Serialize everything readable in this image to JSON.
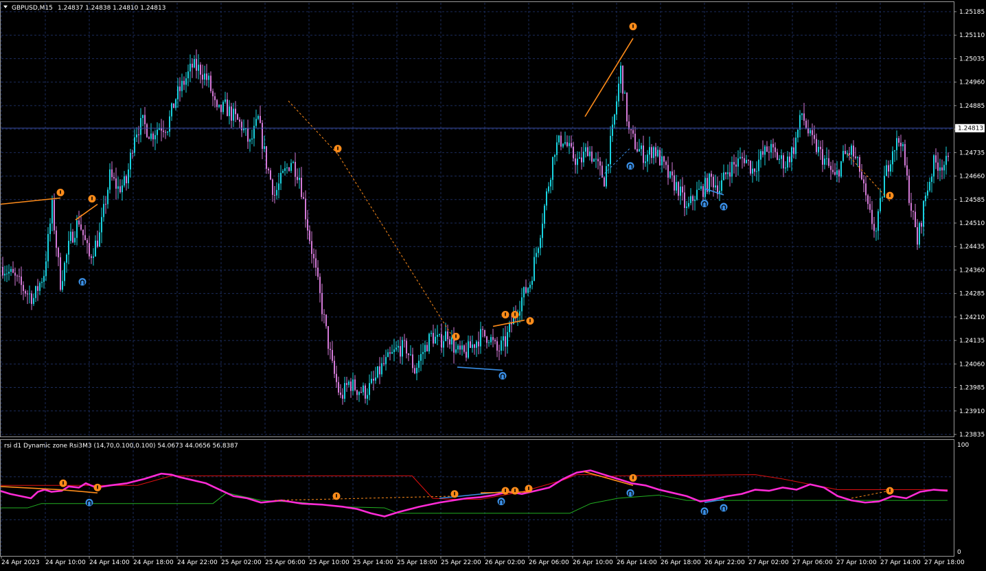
{
  "header": {
    "symbol": "GBPUSD,M15",
    "ohlc": "1.24837 1.24838 1.24810 1.24813"
  },
  "current_price_label": "1.24813",
  "colors": {
    "background": "#000000",
    "grid": "#1c2c5c",
    "bull": "#19d3e0",
    "bear": "#d47ad8",
    "rsi": "#ff2bd6",
    "upper_band": "#e01010",
    "lower_band": "#22b022",
    "sell_signal": "#ff8c1a",
    "buy_signal": "#3a8fe6",
    "current_price_line": "#3a4fa8"
  },
  "icons": {
    "sell_arrow": "sell-signal-icon",
    "buy_arrow": "buy-signal-icon",
    "menu": "triangle-down-icon"
  },
  "chart_data": [
    {
      "type": "candlestick",
      "symbol": "GBPUSD",
      "timeframe": "M15",
      "price_ticks": [
        "1.25185",
        "1.25110",
        "1.25035",
        "1.24960",
        "1.24885",
        "1.24810",
        "1.24735",
        "1.24660",
        "1.24585",
        "1.24510",
        "1.24435",
        "1.24360",
        "1.24285",
        "1.24210",
        "1.24135",
        "1.24060",
        "1.23985",
        "1.23910",
        "1.23835"
      ],
      "ylim": [
        1.23835,
        1.25185
      ],
      "time_ticks": [
        "24 Apr 2023",
        "24 Apr 10:00",
        "24 Apr 14:00",
        "24 Apr 18:00",
        "24 Apr 22:00",
        "25 Apr 02:00",
        "25 Apr 06:00",
        "25 Apr 10:00",
        "25 Apr 14:00",
        "25 Apr 18:00",
        "25 Apr 22:00",
        "26 Apr 02:00",
        "26 Apr 06:00",
        "26 Apr 10:00",
        "26 Apr 14:00",
        "26 Apr 18:00",
        "26 Apr 22:00",
        "27 Apr 02:00",
        "27 Apr 06:00",
        "27 Apr 10:00",
        "27 Apr 14:00",
        "27 Apr 18:00"
      ],
      "close_path": [
        [
          0,
          1.2437
        ],
        [
          5,
          1.2434
        ],
        [
          10,
          1.243
        ],
        [
          15,
          1.2427
        ],
        [
          20,
          1.2435
        ],
        [
          24,
          1.2456
        ],
        [
          28,
          1.2432
        ],
        [
          33,
          1.2446
        ],
        [
          37,
          1.2452
        ],
        [
          42,
          1.244
        ],
        [
          47,
          1.2447
        ],
        [
          52,
          1.2466
        ],
        [
          56,
          1.2462
        ],
        [
          60,
          1.2464
        ],
        [
          64,
          1.248
        ],
        [
          68,
          1.2483
        ],
        [
          72,
          1.2479
        ],
        [
          76,
          1.2482
        ],
        [
          80,
          1.2482
        ],
        [
          84,
          1.2491
        ],
        [
          88,
          1.2496
        ],
        [
          92,
          1.2501
        ],
        [
          96,
          1.25
        ],
        [
          100,
          1.2496
        ],
        [
          104,
          1.2486
        ],
        [
          108,
          1.2488
        ],
        [
          112,
          1.2485
        ],
        [
          116,
          1.2482
        ],
        [
          120,
          1.2476
        ],
        [
          124,
          1.2484
        ],
        [
          128,
          1.247
        ],
        [
          132,
          1.246
        ],
        [
          136,
          1.2466
        ],
        [
          140,
          1.2471
        ],
        [
          144,
          1.2466
        ],
        [
          148,
          1.245
        ],
        [
          152,
          1.2435
        ],
        [
          156,
          1.242
        ],
        [
          160,
          1.2405
        ],
        [
          164,
          1.2395
        ],
        [
          168,
          1.24
        ],
        [
          172,
          1.2398
        ],
        [
          176,
          1.2397
        ],
        [
          180,
          1.24
        ],
        [
          184,
          1.2405
        ],
        [
          188,
          1.2408
        ],
        [
          192,
          1.2411
        ],
        [
          196,
          1.2411
        ],
        [
          200,
          1.2404
        ],
        [
          204,
          1.241
        ],
        [
          208,
          1.2415
        ],
        [
          212,
          1.2413
        ],
        [
          216,
          1.2416
        ],
        [
          220,
          1.241
        ],
        [
          224,
          1.2409
        ],
        [
          228,
          1.2412
        ],
        [
          232,
          1.2415
        ],
        [
          236,
          1.2415
        ],
        [
          240,
          1.241
        ],
        [
          244,
          1.2413
        ],
        [
          248,
          1.2421
        ],
        [
          252,
          1.2427
        ],
        [
          256,
          1.2432
        ],
        [
          260,
          1.2445
        ],
        [
          264,
          1.246
        ],
        [
          268,
          1.2475
        ],
        [
          272,
          1.2478
        ],
        [
          276,
          1.2473
        ],
        [
          280,
          1.247
        ],
        [
          284,
          1.2475
        ],
        [
          288,
          1.247
        ],
        [
          292,
          1.2465
        ],
        [
          296,
          1.248
        ],
        [
          300,
          1.25
        ],
        [
          304,
          1.248
        ],
        [
          308,
          1.2475
        ],
        [
          312,
          1.2472
        ],
        [
          316,
          1.2475
        ],
        [
          320,
          1.247
        ],
        [
          324,
          1.2465
        ],
        [
          328,
          1.2462
        ],
        [
          332,
          1.2455
        ],
        [
          336,
          1.246
        ],
        [
          340,
          1.2462
        ],
        [
          344,
          1.2465
        ],
        [
          348,
          1.2462
        ],
        [
          352,
          1.2468
        ],
        [
          356,
          1.247
        ],
        [
          360,
          1.2472
        ],
        [
          364,
          1.2468
        ],
        [
          368,
          1.2472
        ],
        [
          372,
          1.2475
        ],
        [
          376,
          1.2472
        ],
        [
          380,
          1.247
        ],
        [
          384,
          1.2475
        ],
        [
          388,
          1.2486
        ],
        [
          392,
          1.2478
        ],
        [
          396,
          1.2474
        ],
        [
          400,
          1.247
        ],
        [
          404,
          1.2465
        ],
        [
          408,
          1.2472
        ],
        [
          412,
          1.2474
        ],
        [
          416,
          1.2468
        ],
        [
          420,
          1.2455
        ],
        [
          424,
          1.2448
        ],
        [
          428,
          1.2465
        ],
        [
          432,
          1.2475
        ],
        [
          436,
          1.2478
        ],
        [
          440,
          1.246
        ],
        [
          444,
          1.2445
        ],
        [
          448,
          1.246
        ],
        [
          452,
          1.247
        ],
        [
          456,
          1.247
        ],
        [
          460,
          1.247
        ],
        [
          464,
          1.2481
        ]
      ],
      "signals": [
        {
          "kind": "sell",
          "x": 88,
          "y": 1.2459
        },
        {
          "kind": "sell",
          "x": 134,
          "y": 1.2457
        },
        {
          "kind": "buy",
          "x": 120,
          "y": 1.2434
        },
        {
          "kind": "sell",
          "x": 492,
          "y": 1.2473
        },
        {
          "kind": "sell",
          "x": 664,
          "y": 1.2413
        },
        {
          "kind": "buy",
          "x": 732,
          "y": 1.2404
        },
        {
          "kind": "sell",
          "x": 736,
          "y": 1.242
        },
        {
          "kind": "sell",
          "x": 750,
          "y": 1.242
        },
        {
          "kind": "sell",
          "x": 772,
          "y": 1.2418
        },
        {
          "kind": "sell",
          "x": 922,
          "y": 1.2512
        },
        {
          "kind": "buy",
          "x": 918,
          "y": 1.2471
        },
        {
          "kind": "buy",
          "x": 1026,
          "y": 1.2459
        },
        {
          "kind": "buy",
          "x": 1054,
          "y": 1.2458
        },
        {
          "kind": "sell",
          "x": 1296,
          "y": 1.2458
        }
      ]
    },
    {
      "type": "line",
      "title": "rsi d1 Dynamic zone Rsi3M3 (14,70,0.100,0.100) 54.0673 44.0656 56.8387",
      "ylim": [
        0,
        100
      ],
      "y_ticks": [
        "100",
        "0"
      ],
      "series": [
        {
          "name": "rsi",
          "values": [
            [
              0,
              57
            ],
            [
              15,
              54
            ],
            [
              30,
              52
            ],
            [
              45,
              50
            ],
            [
              55,
              56
            ],
            [
              65,
              58
            ],
            [
              75,
              56
            ],
            [
              90,
              57
            ],
            [
              100,
              61
            ],
            [
              115,
              60
            ],
            [
              125,
              64
            ],
            [
              140,
              60
            ],
            [
              160,
              62
            ],
            [
              185,
              64
            ],
            [
              210,
              68
            ],
            [
              235,
              73
            ],
            [
              250,
              72
            ],
            [
              260,
              70
            ],
            [
              280,
              67
            ],
            [
              300,
              64
            ],
            [
              320,
              58
            ],
            [
              340,
              52
            ],
            [
              360,
              50
            ],
            [
              380,
              46
            ],
            [
              410,
              48
            ],
            [
              440,
              45
            ],
            [
              470,
              44
            ],
            [
              500,
              42
            ],
            [
              520,
              40
            ],
            [
              540,
              36
            ],
            [
              560,
              33
            ],
            [
              580,
              37
            ],
            [
              610,
              42
            ],
            [
              640,
              46
            ],
            [
              660,
              48
            ],
            [
              680,
              50
            ],
            [
              700,
              51
            ],
            [
              720,
              53
            ],
            [
              740,
              56
            ],
            [
              760,
              54
            ],
            [
              780,
              57
            ],
            [
              800,
              60
            ],
            [
              820,
              68
            ],
            [
              840,
              74
            ],
            [
              860,
              76
            ],
            [
              880,
              72
            ],
            [
              900,
              68
            ],
            [
              920,
              64
            ],
            [
              940,
              62
            ],
            [
              960,
              58
            ],
            [
              980,
              55
            ],
            [
              1000,
              52
            ],
            [
              1020,
              47
            ],
            [
              1040,
              49
            ],
            [
              1060,
              52
            ],
            [
              1080,
              54
            ],
            [
              1100,
              58
            ],
            [
              1120,
              57
            ],
            [
              1140,
              60
            ],
            [
              1160,
              58
            ],
            [
              1180,
              63
            ],
            [
              1200,
              60
            ],
            [
              1220,
              52
            ],
            [
              1240,
              48
            ],
            [
              1260,
              46
            ],
            [
              1280,
              47
            ],
            [
              1300,
              52
            ],
            [
              1320,
              50
            ],
            [
              1340,
              56
            ],
            [
              1360,
              58
            ],
            [
              1380,
              57
            ]
          ]
        },
        {
          "name": "upper",
          "values": [
            [
              0,
              62
            ],
            [
              200,
              62
            ],
            [
              250,
              71
            ],
            [
              600,
              71
            ],
            [
              630,
              50
            ],
            [
              660,
              49
            ],
            [
              700,
              49
            ],
            [
              760,
              56
            ],
            [
              820,
              67
            ],
            [
              840,
              72
            ],
            [
              860,
              72
            ],
            [
              880,
              70
            ],
            [
              900,
              71
            ],
            [
              1100,
              72
            ],
            [
              1140,
              68
            ],
            [
              1220,
              58
            ],
            [
              1380,
              58
            ]
          ]
        },
        {
          "name": "lower",
          "values": [
            [
              0,
              41
            ],
            [
              40,
              41
            ],
            [
              60,
              45
            ],
            [
              310,
              45
            ],
            [
              330,
              55
            ],
            [
              380,
              48
            ],
            [
              440,
              46
            ],
            [
              500,
              42
            ],
            [
              560,
              41
            ],
            [
              580,
              36
            ],
            [
              830,
              36
            ],
            [
              860,
              45
            ],
            [
              900,
              50
            ],
            [
              960,
              53
            ],
            [
              1000,
              48
            ],
            [
              1060,
              48
            ],
            [
              1380,
              48
            ]
          ]
        }
      ]
    }
  ]
}
